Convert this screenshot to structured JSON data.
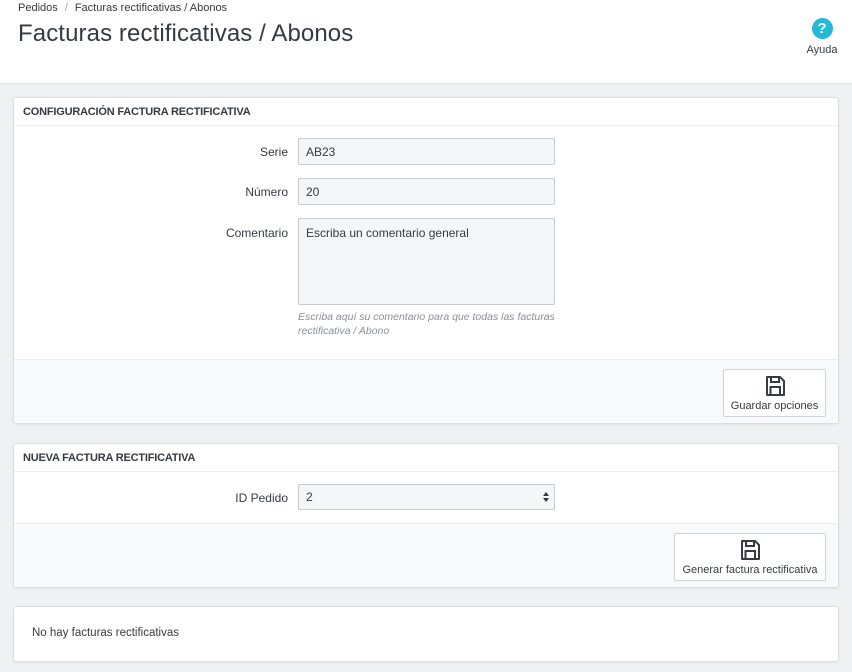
{
  "breadcrumb": {
    "parent": "Pedidos",
    "separator": "/",
    "current": "Facturas rectificativas / Abonos"
  },
  "header": {
    "title": "Facturas rectificativas / Abonos",
    "help_label": "Ayuda",
    "help_symbol": "?"
  },
  "config_panel": {
    "heading": "Configuración factura rectificativa",
    "serie_label": "Serie",
    "serie_value": "AB23",
    "numero_label": "Número",
    "numero_value": "20",
    "comentario_label": "Comentario",
    "comentario_value": "Escriba un comentario general",
    "comentario_help": "Escriba aquí su comentario para que todas las facturas rectificativa / Abono",
    "save_label": "Guardar opciones"
  },
  "new_panel": {
    "heading": "Nueva factura rectificativa",
    "id_label": "ID Pedido",
    "id_value": "2",
    "generate_label": "Generar factura rectificativa"
  },
  "list_panel": {
    "empty_message": "No hay facturas rectificativas"
  },
  "colors": {
    "accent": "#25b9d7",
    "background": "#eff1f2",
    "text": "#363a41"
  },
  "icons": {
    "help": "question-circle-icon",
    "save": "floppy-disk-icon",
    "select": "updown-arrows-icon"
  }
}
